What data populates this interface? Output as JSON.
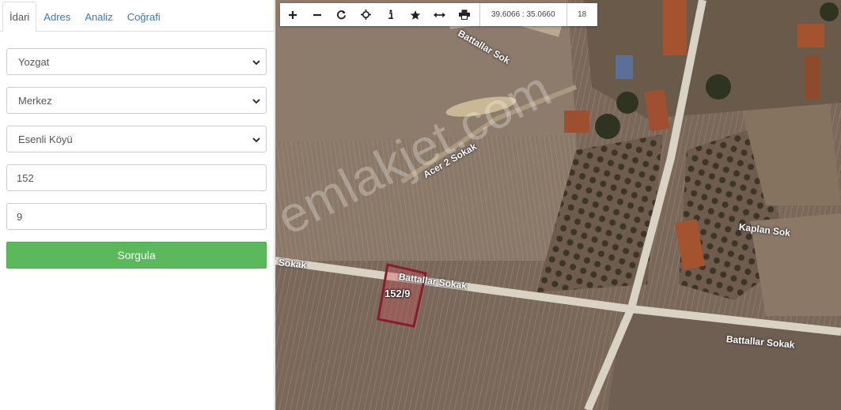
{
  "tabs": [
    {
      "label": "İdari",
      "active": true
    },
    {
      "label": "Adres",
      "active": false
    },
    {
      "label": "Analiz",
      "active": false
    },
    {
      "label": "Coğrafi",
      "active": false
    }
  ],
  "form": {
    "il": "Yozgat",
    "ilce": "Merkez",
    "mahalle": "Esenli Köyü",
    "ada": "152",
    "parsel": "9",
    "submit_label": "Sorgula"
  },
  "map": {
    "toolbar": {
      "buttons": [
        "zoom-in",
        "zoom-out",
        "refresh",
        "locate",
        "info",
        "favorite",
        "measure",
        "print"
      ],
      "coordinates": "39.6066 : 35.0660",
      "zoom_level": "18"
    },
    "watermark": "emlakjet.com",
    "streets": {
      "acer": "Acer 2 Sokak",
      "battallar_1": "Battallar Sokak",
      "battallar_2": "Battallar Sokak",
      "battallar_3": "Battallar Sok",
      "kaplan": "Kaplan Sok",
      "top": "Sokak"
    },
    "parcel_label": "152/9",
    "colors": {
      "parcel_outline": "#8b1a2e",
      "parcel_fill": "rgba(200,80,90,0.35)",
      "button": "#5cb85c"
    }
  }
}
